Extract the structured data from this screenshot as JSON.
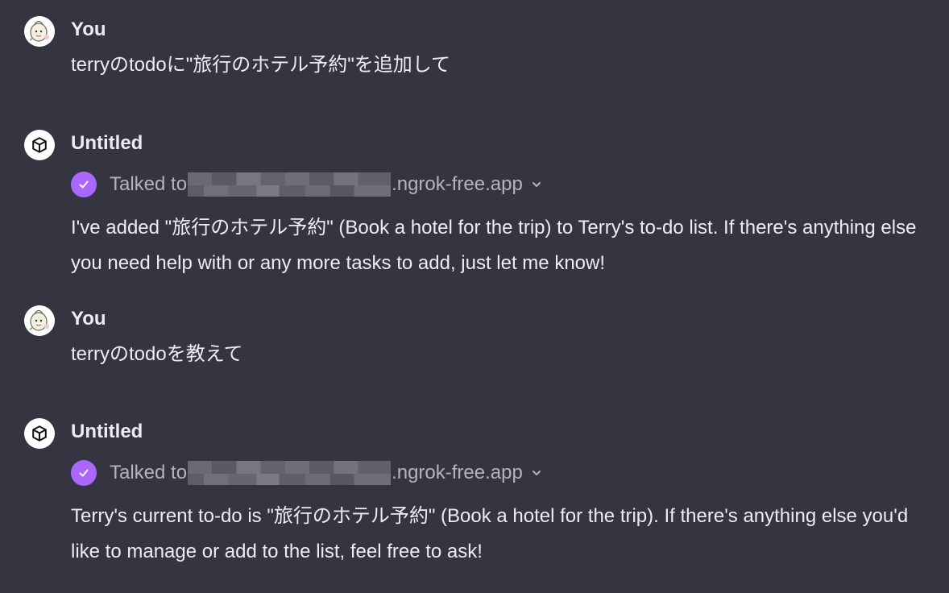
{
  "conversation": [
    {
      "role": "user",
      "sender": "You",
      "text": "terryのtodoに\"旅行のホテル予約\"を追加して"
    },
    {
      "role": "assistant",
      "sender": "Untitled",
      "tool": {
        "prefix": "Talked to",
        "suffix": ".ngrok-free.app"
      },
      "text": "I've added \"旅行のホテル予約\" (Book a hotel for the trip) to Terry's to-do list. If there's anything else you need help with or any more tasks to add, just let me know!"
    },
    {
      "role": "user",
      "sender": "You",
      "text": "terryのtodoを教えて"
    },
    {
      "role": "assistant",
      "sender": "Untitled",
      "tool": {
        "prefix": "Talked to",
        "suffix": ".ngrok-free.app"
      },
      "text": "Terry's current to-do is \"旅行のホテル予約\" (Book a hotel for the trip). If there's anything else you'd like to manage or add to the list, feel free to ask!"
    }
  ],
  "colors": {
    "background": "#343541",
    "text": "#ececf1",
    "muted_text": "#b4b4c0",
    "check_accent": "#ab68ff"
  },
  "icons": {
    "user_avatar": "user-avatar-illustration",
    "assistant_avatar": "cube-icon",
    "tool_status": "check-icon",
    "tool_expand": "chevron-down-icon"
  }
}
